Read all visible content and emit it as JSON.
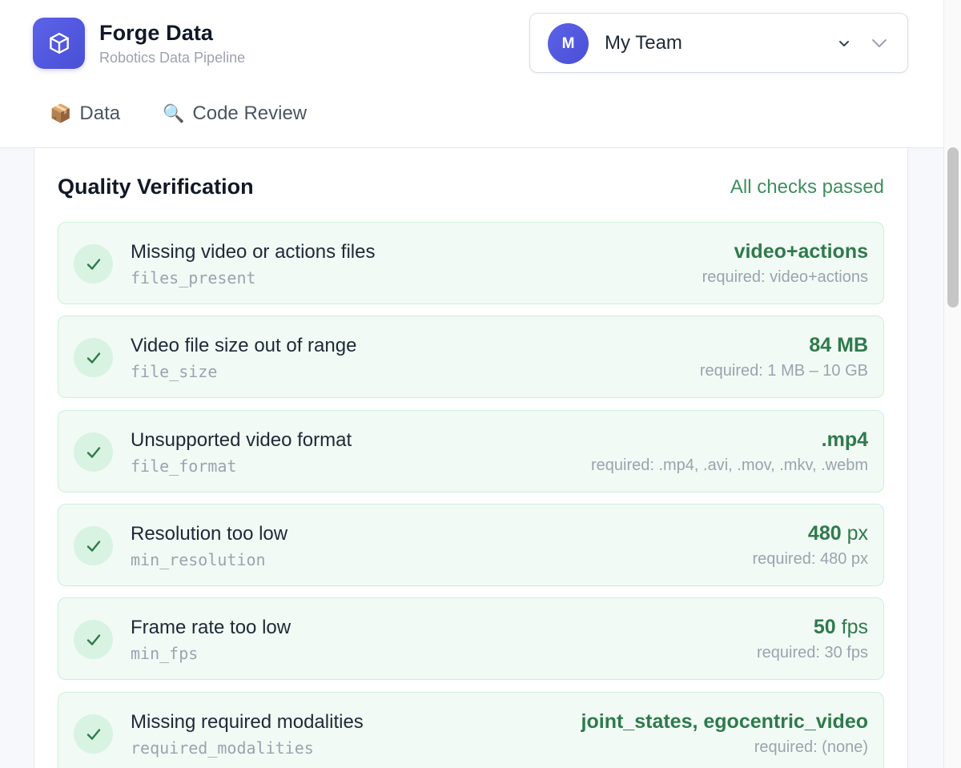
{
  "brand": {
    "title": "Forge Data",
    "subtitle": "Robotics Data Pipeline",
    "logo_icon": "cube-icon",
    "accent": "#5b63e8"
  },
  "team": {
    "avatar_initial": "M",
    "name": "My Team"
  },
  "nav": {
    "tabs": [
      {
        "icon": "📦",
        "label": "Data"
      },
      {
        "icon": "🔍",
        "label": "Code Review"
      }
    ]
  },
  "quality": {
    "title": "Quality Verification",
    "status": "All checks passed",
    "status_color": "#3f8f5f",
    "checks": [
      {
        "label": "Missing video or actions files",
        "key": "files_present",
        "value": "video+actions",
        "unit": "",
        "required": "required: video+actions"
      },
      {
        "label": "Video file size out of range",
        "key": "file_size",
        "value": "84 MB",
        "unit": "",
        "required": "required: 1 MB – 10 GB"
      },
      {
        "label": "Unsupported video format",
        "key": "file_format",
        "value": ".mp4",
        "unit": "",
        "required": "required: .mp4, .avi, .mov, .mkv, .webm"
      },
      {
        "label": "Resolution too low",
        "key": "min_resolution",
        "value": "480",
        "unit": "px",
        "required": "required: 480 px"
      },
      {
        "label": "Frame rate too low",
        "key": "min_fps",
        "value": "50",
        "unit": "fps",
        "required": "required: 30 fps"
      },
      {
        "label": "Missing required modalities",
        "key": "required_modalities",
        "value": "joint_states, egocentric_video",
        "unit": "",
        "required": "required: (none)"
      }
    ]
  }
}
